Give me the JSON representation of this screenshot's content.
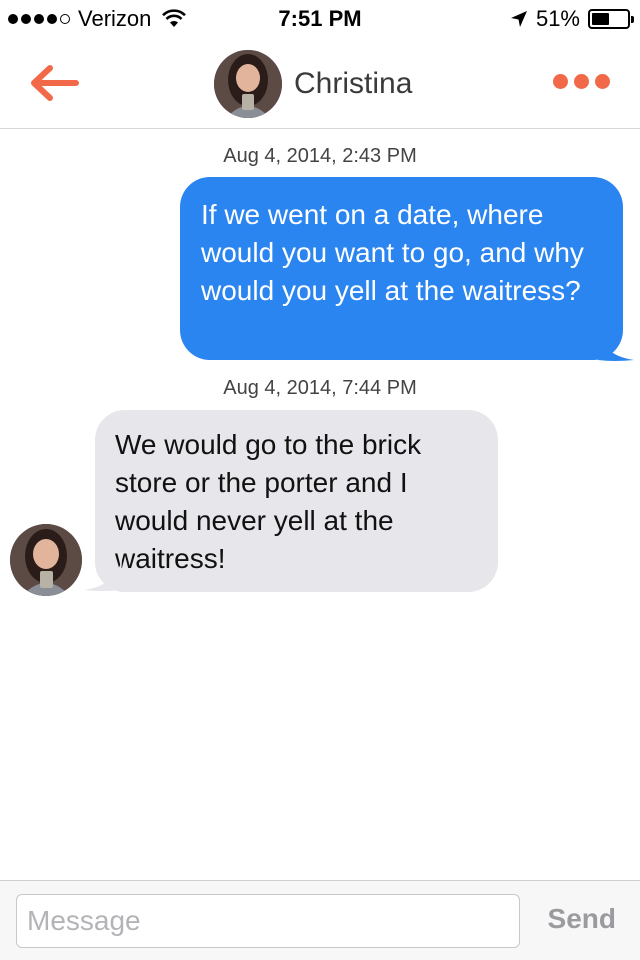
{
  "status_bar": {
    "carrier": "Verizon",
    "time": "7:51 PM",
    "battery": "51%",
    "battery_level": 0.51,
    "signal_bars": 4,
    "icons": [
      "signal-dots-icon",
      "wifi-icon",
      "location-arrow-icon",
      "battery-icon"
    ]
  },
  "header": {
    "title": "Christina",
    "back_icon": "arrow-left-icon",
    "more_icon": "more-dots-icon",
    "accent_color": "#f2694a"
  },
  "messages": [
    {
      "timestamp": "Aug 4, 2014, 2:43 PM",
      "direction": "outgoing",
      "text": "If we went on a date, where would you want to go, and why would you yell at the waitress?",
      "bubble_color": "#2b85f0"
    },
    {
      "timestamp": "Aug 4, 2014, 7:44 PM",
      "direction": "incoming",
      "text": "We would go to the brick store or the porter and I would never yell at the waitress!",
      "bubble_color": "#e6e6eb"
    }
  ],
  "composer": {
    "placeholder": "Message",
    "value": "",
    "send_label": "Send"
  }
}
